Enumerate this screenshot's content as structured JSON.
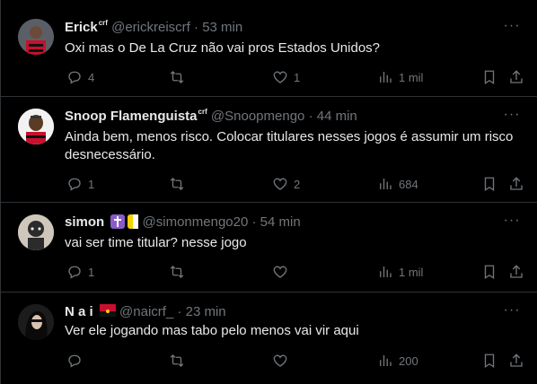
{
  "tweets": [
    {
      "name": "Erick",
      "badge": "crf",
      "handle": "@erickreiscrf",
      "time": "53 min",
      "text": "Oxi mas o De La Cruz não vai pros Estados Unidos?",
      "replies": "4",
      "reposts": "",
      "likes": "1",
      "views": "1 mil"
    },
    {
      "name": "Snoop Flamenguista",
      "badge": "crf",
      "handle": "@Snoopmengo",
      "time": "44 min",
      "text": "Ainda bem, menos risco. Colocar titulares nesses jogos é assumir um risco desnecessário.",
      "replies": "1",
      "reposts": "",
      "likes": "2",
      "views": "684"
    },
    {
      "name": "simon",
      "badge": "",
      "handle": "@simonmengo20",
      "time": "54 min",
      "text": "vai ser time titular? nesse jogo",
      "replies": "1",
      "reposts": "",
      "likes": "",
      "views": "1 mil"
    },
    {
      "name": "N a i",
      "badge": "",
      "handle": "@naicrf_",
      "time": "23 min",
      "text": "Ver ele jogando mas tabo pelo menos vai vir aqui",
      "replies": "",
      "reposts": "",
      "likes": "",
      "views": "200"
    }
  ],
  "separator": "·",
  "more_glyph": "···",
  "colors": {
    "background": "#000000",
    "text": "#e7e9ea",
    "muted": "#71767b",
    "border": "#2f3336"
  },
  "icons": [
    "reply-icon",
    "repost-icon",
    "like-icon",
    "views-icon",
    "bookmark-icon",
    "share-icon",
    "more-icon"
  ]
}
